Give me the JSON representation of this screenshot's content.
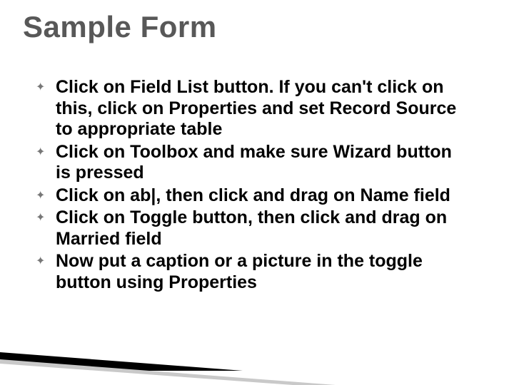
{
  "title": "Sample Form",
  "bullets": [
    "Click on Field List button.  If you can't click on this, click on Properties and set Record Source to appropriate table",
    "Click on Toolbox and make sure Wizard button is pressed",
    "Click on ab|, then click and drag on Name field",
    "Click on Toggle button, then click and drag on Married field",
    "Now put a caption or a picture in the toggle button using Properties"
  ]
}
